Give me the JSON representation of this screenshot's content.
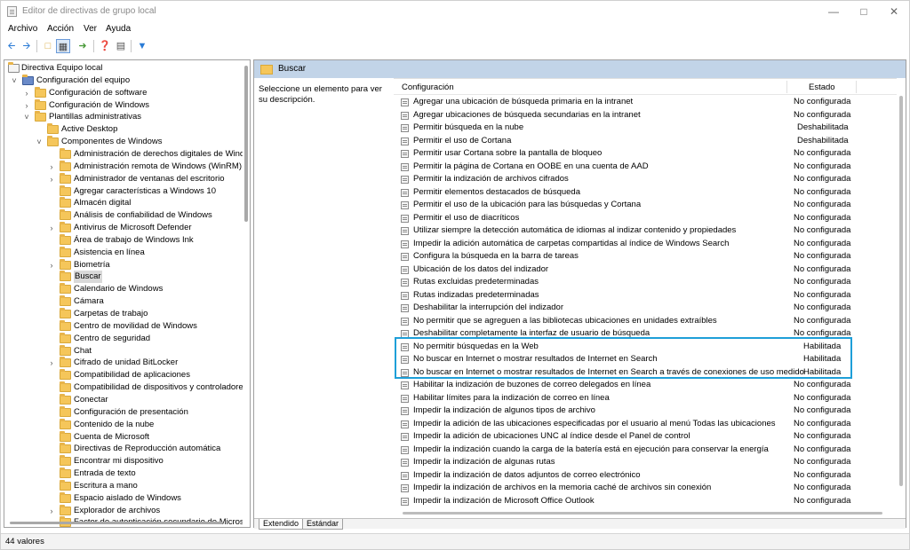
{
  "window": {
    "title": "Editor de directivas de grupo local"
  },
  "menu": [
    "Archivo",
    "Acción",
    "Ver",
    "Ayuda"
  ],
  "tree": [
    {
      "label": "Directiva Equipo local",
      "level": 0,
      "exp": "",
      "icon": "policy"
    },
    {
      "label": "Configuración del equipo",
      "level": 1,
      "exp": "v",
      "icon": "computer"
    },
    {
      "label": "Configuración de software",
      "level": 2,
      "exp": ">",
      "icon": "folder"
    },
    {
      "label": "Configuración de Windows",
      "level": 2,
      "exp": ">",
      "icon": "folder"
    },
    {
      "label": "Plantillas administrativas",
      "level": 2,
      "exp": "v",
      "icon": "folder"
    },
    {
      "label": "Active Desktop",
      "level": 3,
      "exp": "",
      "icon": "folder"
    },
    {
      "label": "Componentes de Windows",
      "level": 3,
      "exp": "v",
      "icon": "folder"
    },
    {
      "label": "Administración de derechos digitales de Wind",
      "level": 4,
      "exp": "",
      "icon": "folder"
    },
    {
      "label": "Administración remota de Windows (WinRM)",
      "level": 4,
      "exp": ">",
      "icon": "folder"
    },
    {
      "label": "Administrador de ventanas del escritorio",
      "level": 4,
      "exp": ">",
      "icon": "folder"
    },
    {
      "label": "Agregar características a Windows 10",
      "level": 4,
      "exp": "",
      "icon": "folder"
    },
    {
      "label": "Almacén digital",
      "level": 4,
      "exp": "",
      "icon": "folder"
    },
    {
      "label": "Análisis de confiabilidad de Windows",
      "level": 4,
      "exp": "",
      "icon": "folder"
    },
    {
      "label": "Antivirus de Microsoft Defender",
      "level": 4,
      "exp": ">",
      "icon": "folder"
    },
    {
      "label": "Área de trabajo de Windows Ink",
      "level": 4,
      "exp": "",
      "icon": "folder"
    },
    {
      "label": "Asistencia en línea",
      "level": 4,
      "exp": "",
      "icon": "folder"
    },
    {
      "label": "Biometría",
      "level": 4,
      "exp": ">",
      "icon": "folder"
    },
    {
      "label": "Buscar",
      "level": 4,
      "exp": "",
      "icon": "folder",
      "selected": true
    },
    {
      "label": "Calendario de Windows",
      "level": 4,
      "exp": "",
      "icon": "folder"
    },
    {
      "label": "Cámara",
      "level": 4,
      "exp": "",
      "icon": "folder"
    },
    {
      "label": "Carpetas de trabajo",
      "level": 4,
      "exp": "",
      "icon": "folder"
    },
    {
      "label": "Centro de movilidad de Windows",
      "level": 4,
      "exp": "",
      "icon": "folder"
    },
    {
      "label": "Centro de seguridad",
      "level": 4,
      "exp": "",
      "icon": "folder"
    },
    {
      "label": "Chat",
      "level": 4,
      "exp": "",
      "icon": "folder"
    },
    {
      "label": "Cifrado de unidad BitLocker",
      "level": 4,
      "exp": ">",
      "icon": "folder"
    },
    {
      "label": "Compatibilidad de aplicaciones",
      "level": 4,
      "exp": "",
      "icon": "folder"
    },
    {
      "label": "Compatibilidad de dispositivos y controladore",
      "level": 4,
      "exp": "",
      "icon": "folder"
    },
    {
      "label": "Conectar",
      "level": 4,
      "exp": "",
      "icon": "folder"
    },
    {
      "label": "Configuración de presentación",
      "level": 4,
      "exp": "",
      "icon": "folder"
    },
    {
      "label": "Contenido de la nube",
      "level": 4,
      "exp": "",
      "icon": "folder"
    },
    {
      "label": "Cuenta de Microsoft",
      "level": 4,
      "exp": "",
      "icon": "folder"
    },
    {
      "label": "Directivas de Reproducción automática",
      "level": 4,
      "exp": "",
      "icon": "folder"
    },
    {
      "label": "Encontrar mi dispositivo",
      "level": 4,
      "exp": "",
      "icon": "folder"
    },
    {
      "label": "Entrada de texto",
      "level": 4,
      "exp": "",
      "icon": "folder"
    },
    {
      "label": "Escritura a mano",
      "level": 4,
      "exp": "",
      "icon": "folder"
    },
    {
      "label": "Espacio aislado de Windows",
      "level": 4,
      "exp": "",
      "icon": "folder"
    },
    {
      "label": "Explorador de archivos",
      "level": 4,
      "exp": ">",
      "icon": "folder"
    },
    {
      "label": "Factor de autenticación secundario de Micros",
      "level": 4,
      "exp": "",
      "icon": "folder"
    }
  ],
  "right": {
    "header": "Buscar",
    "description": "Seleccione un elemento para ver su descripción.",
    "col_config": "Configuración",
    "col_state": "Estado"
  },
  "policies": [
    {
      "name": "Agregar una ubicación de búsqueda primaria en la intranet",
      "state": "No configurada"
    },
    {
      "name": "Agregar ubicaciones de búsqueda secundarias en la intranet",
      "state": "No configurada"
    },
    {
      "name": "Permitir búsqueda en la nube",
      "state": "Deshabilitada"
    },
    {
      "name": "Permitir el uso de Cortana",
      "state": "Deshabilitada"
    },
    {
      "name": "Permitir usar Cortana sobre la pantalla de bloqueo",
      "state": "No configurada"
    },
    {
      "name": "Permitir la página de Cortana en OOBE en una cuenta de AAD",
      "state": "No configurada"
    },
    {
      "name": "Permitir la indización de archivos cifrados",
      "state": "No configurada"
    },
    {
      "name": "Permitir elementos destacados de búsqueda",
      "state": "No configurada"
    },
    {
      "name": "Permitir el uso de la ubicación para las búsquedas y Cortana",
      "state": "No configurada"
    },
    {
      "name": "Permitir el uso de diacríticos",
      "state": "No configurada"
    },
    {
      "name": "Utilizar siempre la detección automática de idiomas al indizar contenido y propiedades",
      "state": "No configurada"
    },
    {
      "name": "Impedir la adición automática de carpetas compartidas al índice de Windows Search",
      "state": "No configurada"
    },
    {
      "name": "Configura la búsqueda en la barra de tareas",
      "state": "No configurada"
    },
    {
      "name": "Ubicación de los datos del indizador",
      "state": "No configurada"
    },
    {
      "name": "Rutas excluidas predeterminadas",
      "state": "No configurada"
    },
    {
      "name": "Rutas indizadas predeterminadas",
      "state": "No configurada"
    },
    {
      "name": "Deshabilitar la interrupción del indizador",
      "state": "No configurada"
    },
    {
      "name": "No permitir que se agreguen a las bibliotecas ubicaciones en unidades extraíbles",
      "state": "No configurada"
    },
    {
      "name": "Deshabilitar completamente la interfaz de usuario de búsqueda",
      "state": "No configurada"
    },
    {
      "name": "No permitir búsquedas en la Web",
      "state": "Habilitada"
    },
    {
      "name": "No buscar en Internet o mostrar resultados de Internet en Search",
      "state": "Habilitada"
    },
    {
      "name": "No buscar en Internet o mostrar resultados de Internet en Search a través de conexiones de uso medido",
      "state": "Habilitada"
    },
    {
      "name": "Habilitar la indización de buzones de correo delegados en línea",
      "state": "No configurada"
    },
    {
      "name": "Habilitar límites para la indización de correo en línea",
      "state": "No configurada"
    },
    {
      "name": "Impedir la indización de algunos tipos de archivo",
      "state": "No configurada"
    },
    {
      "name": "Impedir la adición de las ubicaciones especificadas por el usuario al menú Todas las ubicaciones",
      "state": "No configurada"
    },
    {
      "name": "Impedir la adición de ubicaciones UNC al índice desde el Panel de control",
      "state": "No configurada"
    },
    {
      "name": "Impedir la indización cuando la carga de la batería está en ejecución para conservar la energía",
      "state": "No configurada"
    },
    {
      "name": "Impedir la indización de algunas rutas",
      "state": "No configurada"
    },
    {
      "name": "Impedir la indización de datos adjuntos de correo electrónico",
      "state": "No configurada"
    },
    {
      "name": "Impedir la indización de archivos en la memoria caché de archivos sin conexión",
      "state": "No configurada"
    },
    {
      "name": "Impedir la indización de Microsoft Office Outlook",
      "state": "No configurada"
    }
  ],
  "tabs": [
    "Extendido",
    "Estándar"
  ],
  "status": "44 valores"
}
